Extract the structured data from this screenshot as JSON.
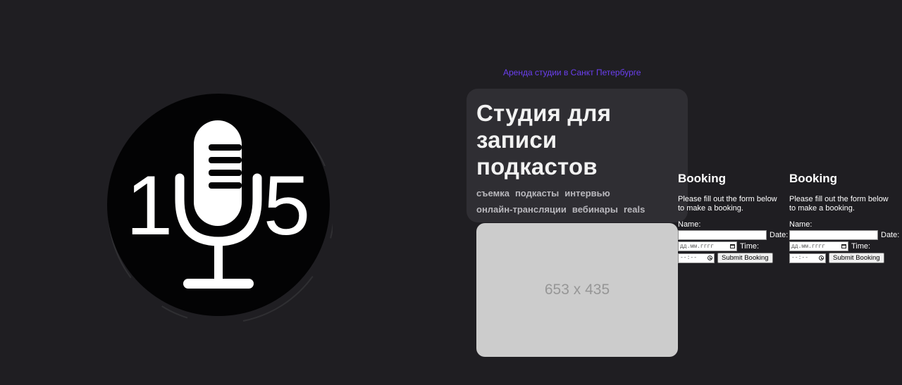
{
  "logo": {
    "left_digit": "1",
    "right_digit": "5"
  },
  "top_link": "Аренда студии в Санкт Петербурге",
  "hero": {
    "title": "Студия для записи подкастов",
    "tags": [
      "съемка",
      "подкасты",
      "интервью",
      "онлайн-трансляции",
      "вебинары",
      "reals"
    ]
  },
  "placeholder": {
    "label": "653 x 435"
  },
  "booking_forms": [
    {
      "title": "Booking",
      "description": "Please fill out the form below to make a booking.",
      "name_label": "Name:",
      "name_value": "",
      "date_label": "Date:",
      "date_placeholder": "дд.мм.гггг",
      "time_label": "Time:",
      "time_placeholder": "--:--",
      "submit_label": "Submit Booking"
    },
    {
      "title": "Booking",
      "description": "Please fill out the form below to make a booking.",
      "name_label": "Name:",
      "name_value": "",
      "date_label": "Date:",
      "date_placeholder": "дд.мм.гггг",
      "time_label": "Time:",
      "time_placeholder": "--:--",
      "submit_label": "Submit Booking"
    }
  ],
  "colors": {
    "background": "#1f1e22",
    "card": "#2f2e33",
    "link": "#6b3ff0",
    "placeholder": "#cccccc"
  }
}
